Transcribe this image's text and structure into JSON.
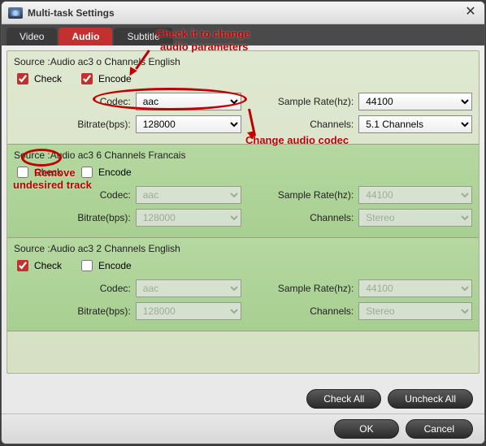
{
  "window": {
    "title": "Multi-task Settings"
  },
  "tabs": {
    "video": "Video",
    "audio": "Audio",
    "subtitle": "Subtitle"
  },
  "labels": {
    "check": "Check",
    "encode": "Encode",
    "codec": "Codec:",
    "sample_rate": "Sample Rate(hz):",
    "bitrate": "Bitrate(bps):",
    "channels": "Channels:"
  },
  "tracks": [
    {
      "source": "Source :Audio  ac3  o Channels  English",
      "check": true,
      "encode": true,
      "enabled": true,
      "codec": "aac",
      "sample_rate": "44100",
      "bitrate": "128000",
      "channels": "5.1 Channels"
    },
    {
      "source": "Source :Audio  ac3  6 Channels  Francais",
      "check": false,
      "encode": false,
      "enabled": false,
      "codec": "aac",
      "sample_rate": "44100",
      "bitrate": "128000",
      "channels": "Stereo"
    },
    {
      "source": "Source :Audio  ac3  2 Channels  English",
      "check": true,
      "encode": false,
      "enabled": false,
      "codec": "aac",
      "sample_rate": "44100",
      "bitrate": "128000",
      "channels": "Stereo"
    }
  ],
  "buttons": {
    "check_all": "Check All",
    "uncheck_all": "Uncheck All",
    "ok": "OK",
    "cancel": "Cancel"
  },
  "annotations": {
    "a1": "Check it to change",
    "a2": "audio parameters",
    "a3": "Change audio codec",
    "a4": "Remove",
    "a5": "undesired track"
  }
}
